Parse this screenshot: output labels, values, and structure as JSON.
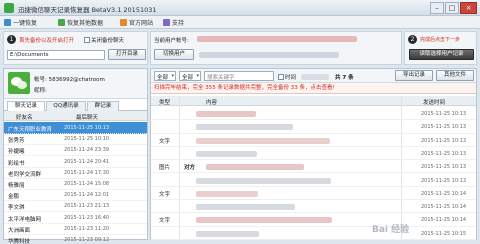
{
  "window": {
    "title": "迅捷微信聊天记录恢复器 BetaV3.1 20151031",
    "minimize": "–",
    "maximize": "□",
    "close": "×"
  },
  "menu": [
    {
      "label": "一键恢复",
      "icon": "restore-icon",
      "color": "#3a8ed0"
    },
    {
      "label": "恢复其他数据",
      "icon": "data-icon",
      "color": "#4aa64a"
    },
    {
      "label": "官方网站",
      "icon": "home-icon",
      "color": "#e08a2b"
    },
    {
      "label": "支持",
      "icon": "help-icon",
      "color": "#7c6bc5"
    }
  ],
  "step1": {
    "number": "1",
    "text": "首先备份以及开启打开",
    "checkbox_label": "关闭备份聊天",
    "path": "E:\\Documents",
    "open_button": "打开目录"
  },
  "step_user": {
    "account_label": "当前用户帐号:",
    "switch_button": "切换用户",
    "account_masked": "****************"
  },
  "step2": {
    "number": "2",
    "text": "完成后点击下一步",
    "export_button": "读取选择用户记录"
  },
  "profile": {
    "account": "帐号: 5836992@chatroom",
    "nickname": "昵称:"
  },
  "tabs": [
    "聊天记录",
    "QQ通讯录",
    "群记录"
  ],
  "contacts_header": {
    "name": "好友名",
    "time": "最后聊天"
  },
  "contacts": [
    {
      "name": "广东天翔职业教育",
      "time": "2015-11-25 10:13",
      "selected": true
    },
    {
      "name": "张秀芳",
      "time": "2015-11-25 10:10",
      "selected": false
    },
    {
      "name": "孙婕曦",
      "time": "2015-11-24 23:39",
      "selected": false
    },
    {
      "name": "彩绘书",
      "time": "2015-11-24 20:41",
      "selected": false
    },
    {
      "name": "老同学交流群",
      "time": "2015-11-24 17:30",
      "selected": false
    },
    {
      "name": "杨雅丽",
      "time": "2015-11-24 15:08",
      "selected": false
    },
    {
      "name": "金鹏",
      "time": "2015-11-24 12:01",
      "selected": false
    },
    {
      "name": "李文琪",
      "time": "2015-11-23 21:13",
      "selected": false
    },
    {
      "name": "太平洋电脑网",
      "time": "2015-11-23 16:40",
      "selected": false
    },
    {
      "name": "大洲画面",
      "time": "2015-11-23 11:20",
      "selected": false
    },
    {
      "name": "华腾科技",
      "time": "2015-11-23 09:12",
      "selected": false
    }
  ],
  "filter": {
    "type_select": "全部",
    "sender_select": "全部",
    "search_placeholder": "搜索关键字",
    "date_checkbox": "时间",
    "count": "共 7 条",
    "export_button": "导出记录",
    "other_button": "其他文件"
  },
  "notice": "扫描完毕结束，完全 355 条记录数据共完整，完全备份 33 条，点击查看!",
  "table_header": {
    "type": "类型",
    "content": "内容",
    "time": "发送时间"
  },
  "messages": [
    {
      "type": "",
      "sender": "",
      "time": "2015-11-25 10:13"
    },
    {
      "type": "",
      "sender": "",
      "time": "2015-11-25 10:13"
    },
    {
      "type": "文字",
      "sender": "",
      "time": "2015-11-25 10:13"
    },
    {
      "type": "",
      "sender": "",
      "time": "2015-11-25 10:13"
    },
    {
      "type": "图片",
      "sender": "对方",
      "time": "2015-11-25 10:13"
    },
    {
      "type": "",
      "sender": "",
      "time": "2015-11-25 10:13"
    },
    {
      "type": "文字",
      "sender": "",
      "time": "2015-11-25 10:14"
    },
    {
      "type": "",
      "sender": "",
      "time": "2015-11-25 10:14"
    },
    {
      "type": "文字",
      "sender": "",
      "time": "2015-11-25 10:14"
    },
    {
      "type": "",
      "sender": "",
      "time": "2015-11-25 10:15"
    }
  ],
  "watermark": "Bai 经验"
}
